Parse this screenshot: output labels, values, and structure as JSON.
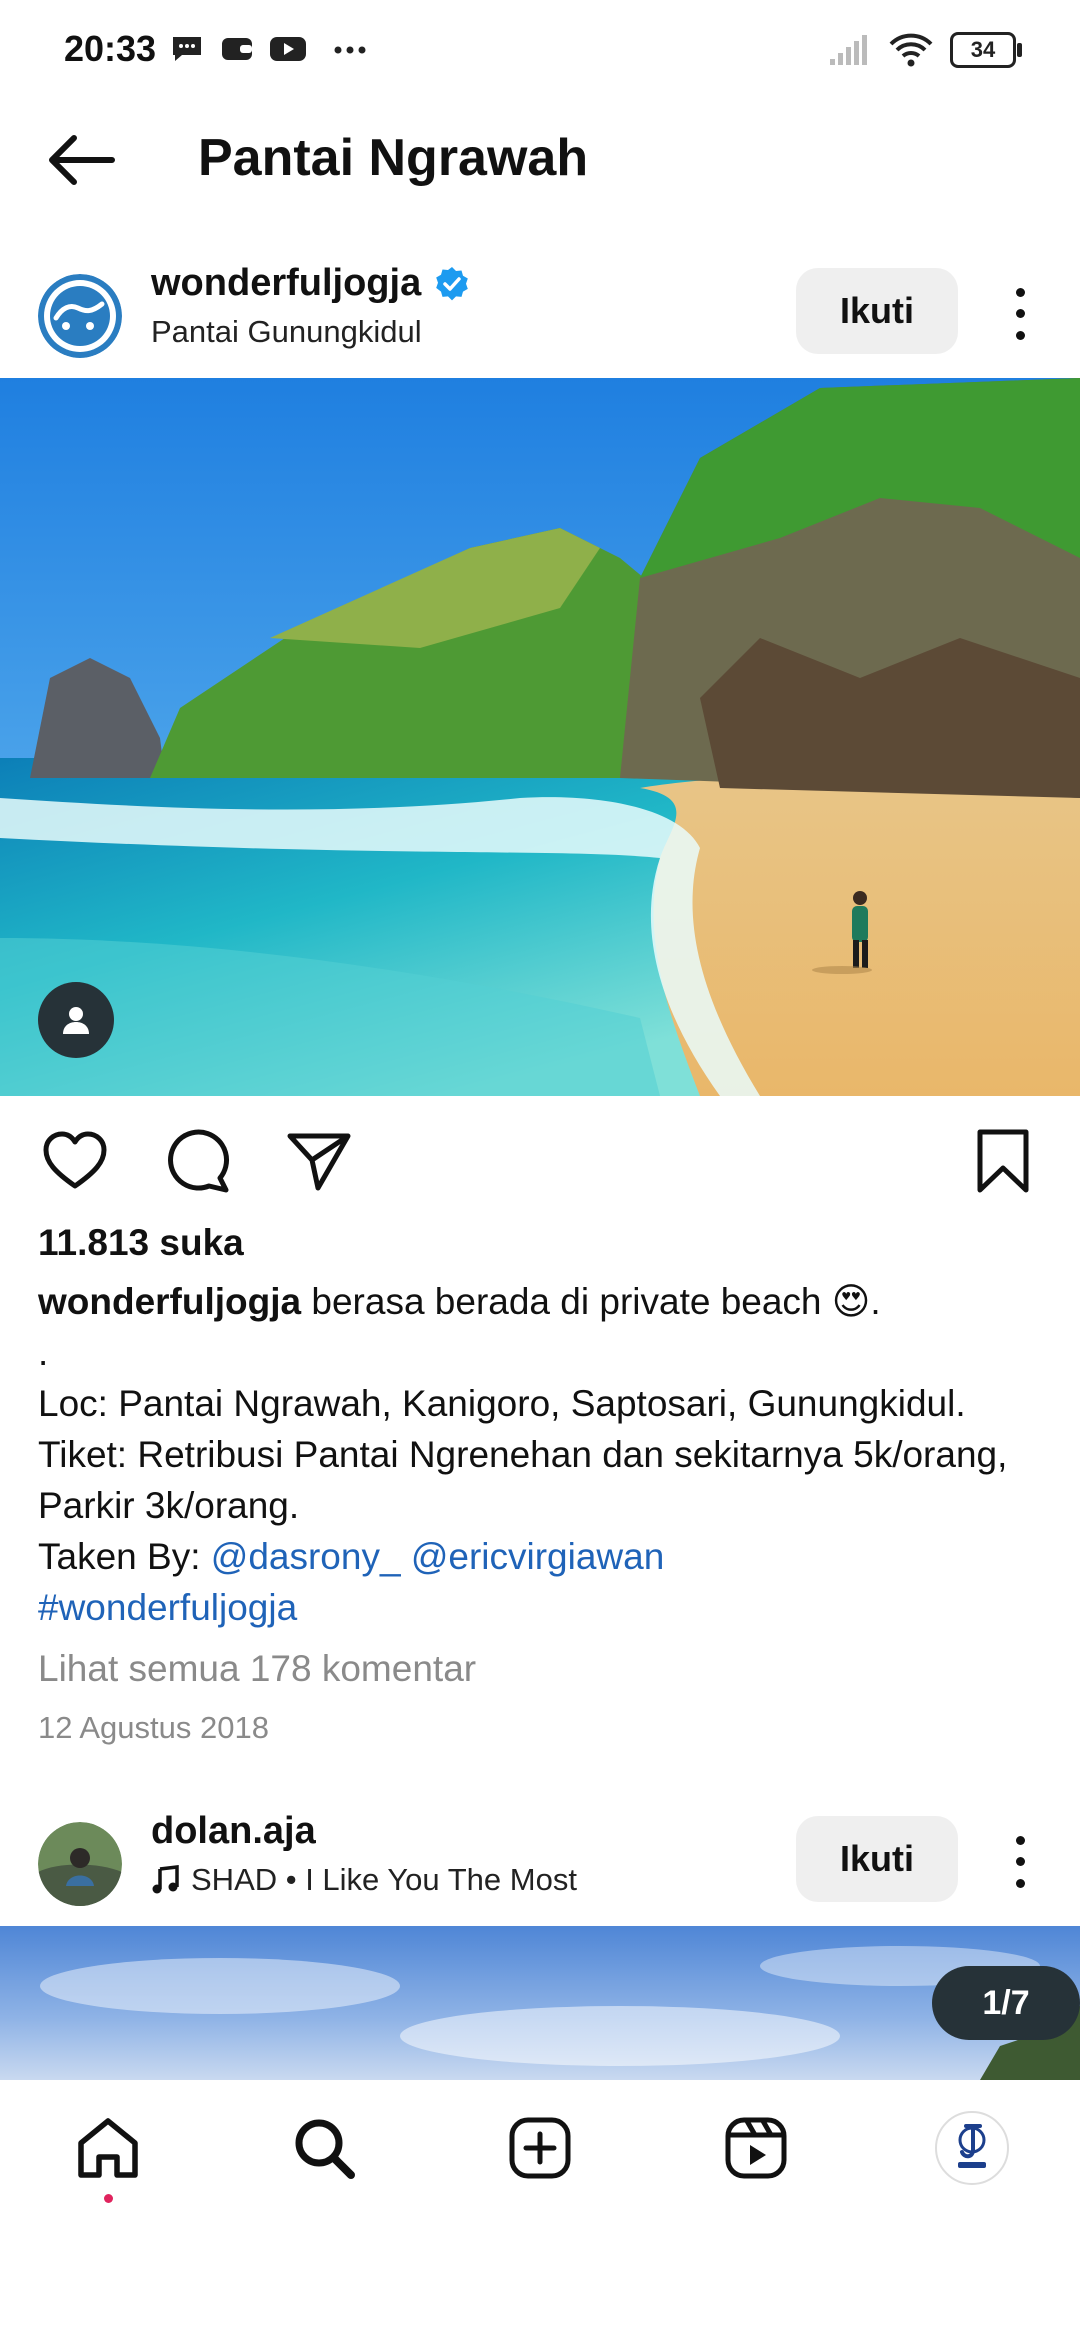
{
  "status_bar": {
    "time": "20:33",
    "battery": "34",
    "icons": [
      "message-icon",
      "wallet-icon",
      "youtube-icon",
      "more-dots-icon",
      "signal-icon",
      "wifi-icon",
      "battery-icon"
    ]
  },
  "header": {
    "back_icon": "arrow-left-icon",
    "title": "Pantai Ngrawah"
  },
  "post1": {
    "username": "wonderfuljogja",
    "verified": true,
    "location": "Pantai Gunungkidul",
    "follow_label": "Ikuti",
    "likes": "11.813 suka",
    "caption": {
      "username": "wonderfuljogja",
      "text": " berasa berada di private beach 😍.",
      "line_dot": ".",
      "loc_line": "Loc: Pantai Ngrawah, Kanigoro, Saptosari, Gunungkidul.",
      "ticket_line": "Tiket: Retribusi Pantai Ngrenehan dan sekitarnya 5k/orang, Parkir 3k/orang.",
      "taken_by_label": "Taken By: ",
      "mention1": "@dasrony_",
      "mention2": "@ericvirgiawan",
      "hashtag": "#wonderfuljogja"
    },
    "comments_link": "Lihat semua 178 komentar",
    "date": "12 Agustus 2018"
  },
  "post2": {
    "username": "dolan.aja",
    "music": "SHAD • I Like You The Most",
    "follow_label": "Ikuti",
    "counter": "1/7"
  },
  "bottom_nav": {
    "items": [
      "home-icon",
      "search-icon",
      "add-post-icon",
      "reels-icon",
      "profile-avatar"
    ]
  },
  "colors": {
    "link": "#1f63b8",
    "verified": "#1d9bf0",
    "muted": "#8a8a8a",
    "button_bg": "#efefef"
  }
}
